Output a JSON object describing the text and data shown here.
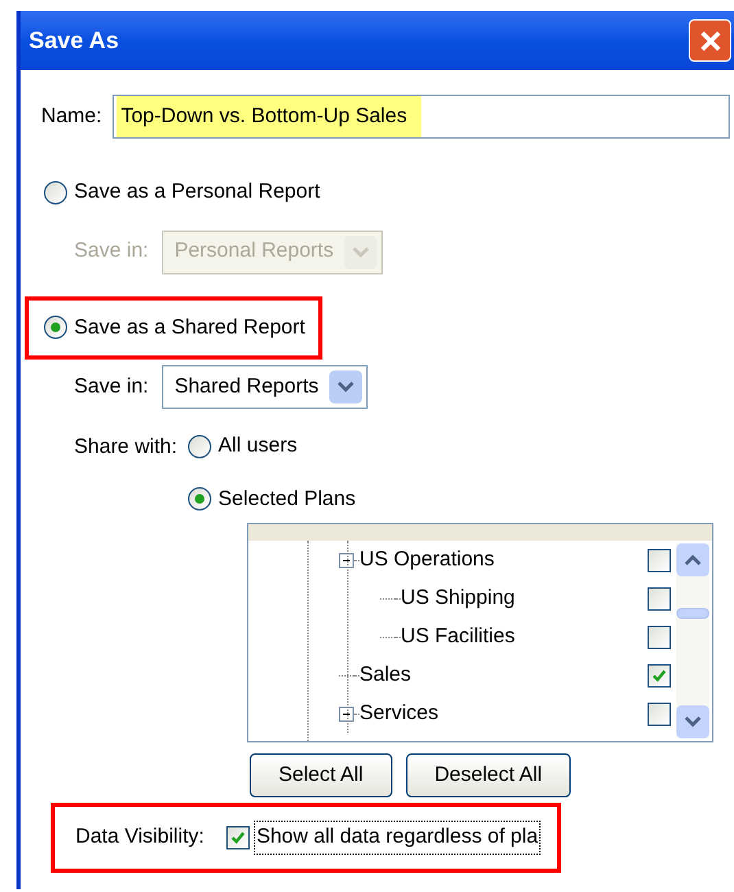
{
  "window": {
    "title": "Save As"
  },
  "name_field": {
    "label": "Name:",
    "value": "Top-Down vs. Bottom-Up Sales",
    "highlighted": true
  },
  "report_options": [
    {
      "label": "Save as a Personal Report",
      "selected": false,
      "highlighted": false,
      "save_in": {
        "label": "Save in:",
        "value": "Personal Reports",
        "disabled": true
      }
    },
    {
      "label": "Save as a Shared Report",
      "selected": true,
      "highlighted": true,
      "save_in": {
        "label": "Save in:",
        "value": "Shared Reports",
        "disabled": false
      }
    }
  ],
  "share_with": {
    "label": "Share with:",
    "options": [
      {
        "label": "All users",
        "selected": false
      },
      {
        "label": "Selected Plans",
        "selected": true
      }
    ]
  },
  "plan_tree": [
    {
      "label": "US Operations",
      "expanded": true,
      "checked": false,
      "children": [
        {
          "label": "US Shipping",
          "checked": false
        },
        {
          "label": "US Facilities",
          "checked": false
        }
      ]
    },
    {
      "label": "Sales",
      "checked": true
    },
    {
      "label": "Services",
      "expanded": true,
      "checked": false
    }
  ],
  "buttons": [
    "Select All",
    "Deselect All"
  ],
  "data_visibility": {
    "label": "Data Visibility:",
    "checkbox_label": "Show all data regardless of pla",
    "checked": true,
    "focused": true,
    "highlighted": true
  }
}
